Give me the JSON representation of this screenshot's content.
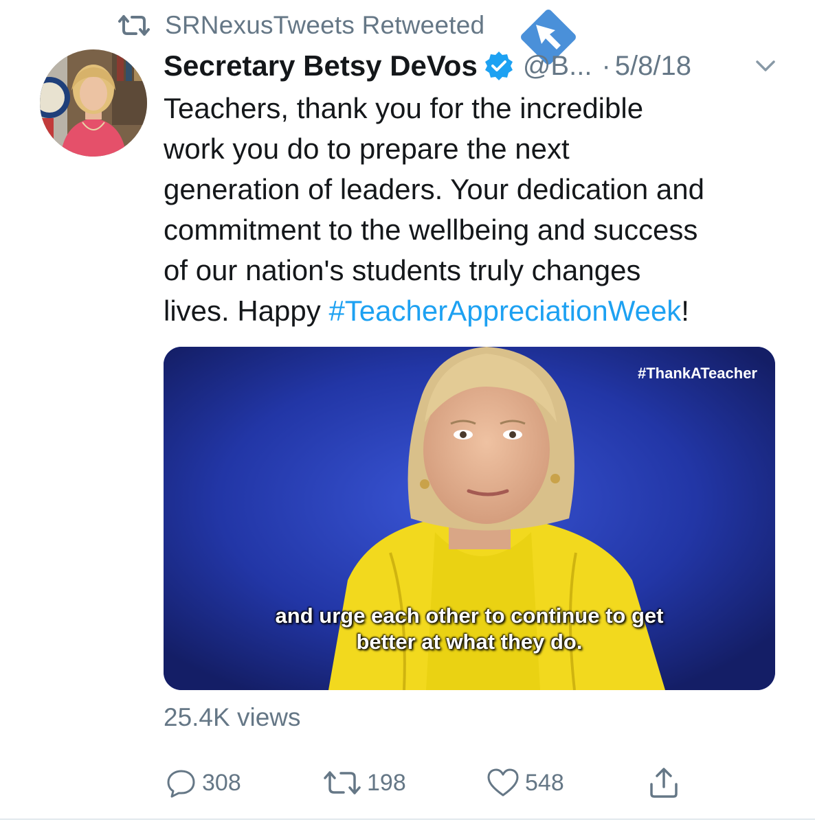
{
  "retweet_banner": {
    "text": "SRNexusTweets Retweeted",
    "icon": "retweet-icon"
  },
  "badge": {
    "icon": "cursor-arrow-badge",
    "color": "#4a90d9"
  },
  "author": {
    "name": "Secretary Betsy DeVos",
    "handle": "@B...",
    "separator": "·",
    "date": "5/8/18",
    "verified_icon": "verified-check-icon",
    "verified_color": "#1da1f2"
  },
  "tweet": {
    "lines": [
      "Teachers, thank you for the incredible",
      "work you do to prepare the next",
      "generation of leaders. Your dedication and",
      "commitment to the wellbeing and success",
      "of our nation's students truly changes"
    ],
    "last_line_prefix": "lives. Happy ",
    "hashtag": "#TeacherAppreciationWeek",
    "last_line_suffix": "!"
  },
  "media": {
    "tag": "#ThankATeacher",
    "caption_line1": "and urge each other to continue to get",
    "caption_line2": "better at what they do."
  },
  "views": "25.4K views",
  "actions": {
    "reply_count": "308",
    "retweet_count": "198",
    "like_count": "548"
  },
  "colors": {
    "accent": "#1da1f2",
    "muted": "#657786",
    "text": "#14171a"
  }
}
